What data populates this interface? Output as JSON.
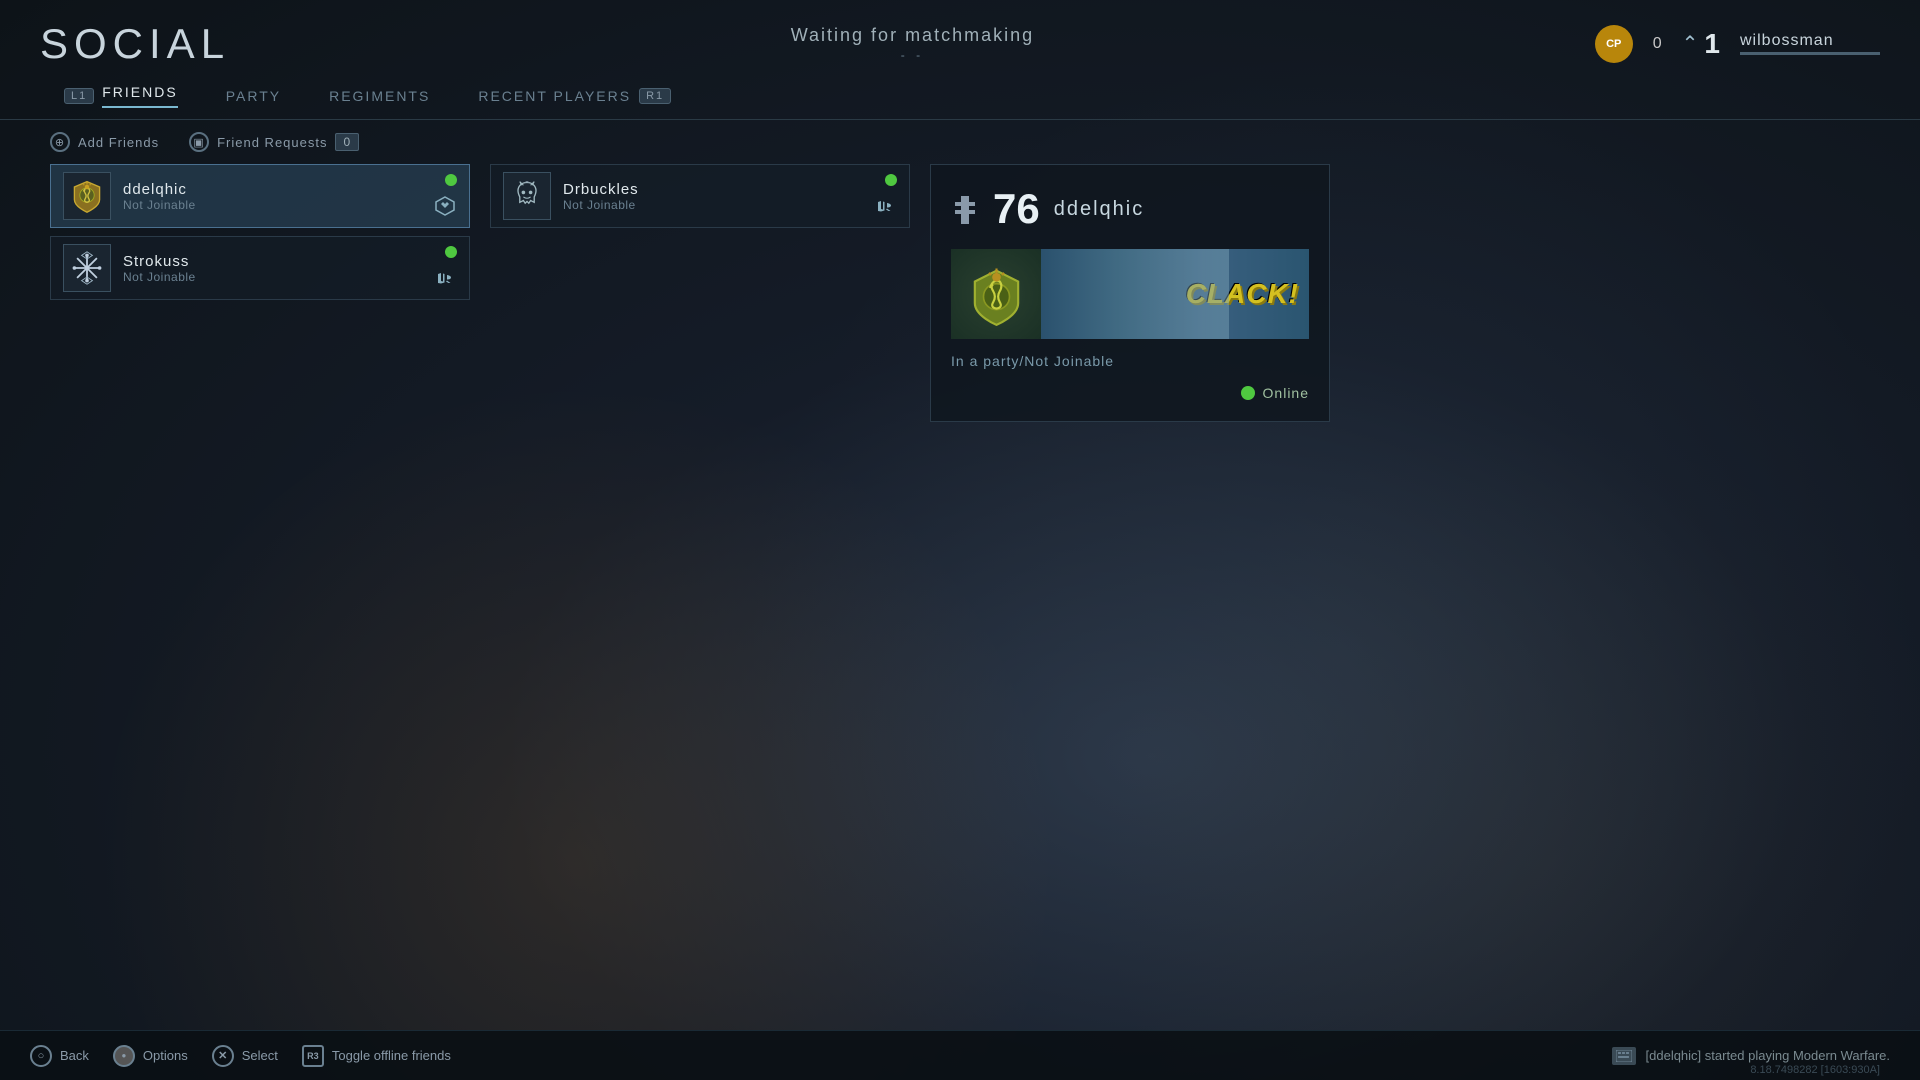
{
  "page": {
    "title": "SOCIAL",
    "background_color": "#1a2030"
  },
  "header": {
    "title": "SOCIAL",
    "matchmaking_status": "Waiting for matchmaking",
    "matchmaking_dots": "- -",
    "cp_label": "CP",
    "cp_value": "0",
    "rank": "1",
    "username": "wilbossman"
  },
  "nav": {
    "tabs": [
      {
        "key": "L1",
        "label": "FRIENDS",
        "active": true
      },
      {
        "key": "",
        "label": "PARTY",
        "active": false
      },
      {
        "key": "",
        "label": "REGIMENTS",
        "active": false
      },
      {
        "key": "R1",
        "label": "RECENT PLAYERS",
        "active": false
      }
    ]
  },
  "secondary_actions": [
    {
      "icon": "circle-a",
      "label": "Add Friends"
    },
    {
      "icon": "circle-d",
      "label": "Friend Requests",
      "count": "0"
    }
  ],
  "friends": {
    "column1": [
      {
        "name": "ddelqhic",
        "status": "Not Joinable",
        "online": true,
        "platform": "cod",
        "selected": true
      },
      {
        "name": "Strokuss",
        "status": "Not Joinable",
        "online": true,
        "platform": "playstation",
        "selected": false
      }
    ],
    "column2": [
      {
        "name": "Drbuckles",
        "status": "Not Joinable",
        "online": true,
        "platform": "playstation",
        "selected": false
      }
    ]
  },
  "profile_panel": {
    "level": "76",
    "username": "ddelqhic",
    "status": "In a party/Not Joinable",
    "online_status": "Online",
    "banner_text": "CLACK!"
  },
  "bottom_controls": [
    {
      "key": "○",
      "type": "circle",
      "label": "Back"
    },
    {
      "key": "●",
      "type": "circle-filled",
      "label": "Options"
    },
    {
      "key": "✕",
      "type": "circle",
      "label": "Select"
    },
    {
      "key": "R3",
      "type": "square",
      "label": "Toggle offline friends"
    }
  ],
  "notification": {
    "text": "[ddelqhic] started playing Modern Warfare."
  },
  "version": "8.18.7498282 [1603:930A]"
}
